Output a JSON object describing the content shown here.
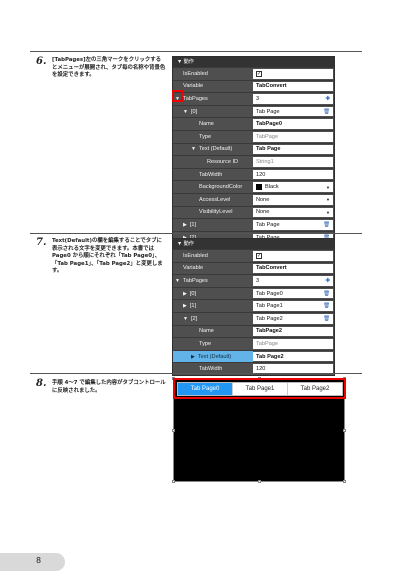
{
  "steps": [
    {
      "num": "6.",
      "text": "[TabPages]左の三角マークをクリックするとメニューが展開され、タブ毎の名称や背景色を設定できます。"
    },
    {
      "num": "7.",
      "text": "Text(Default)の欄を編集することでタブに表示される文字を変更できます。本書では Page0 から順にそれぞれ「Tab Page0」、「Tab Page1」、「Tab Page2」と変更します。"
    },
    {
      "num": "8.",
      "text": "手順 4～7 で編集した内容がタブコントロールに反映されました。"
    }
  ],
  "panel1": {
    "header": "▼ 動作",
    "rows": [
      {
        "name": "IsEnabled",
        "value": "✓"
      },
      {
        "name": "Variable",
        "value": "TabConvert"
      },
      {
        "name": "TabPages",
        "value": "3"
      },
      {
        "name": "[0]",
        "value": "Tab Page"
      },
      {
        "name": "Name",
        "value": "TabPage0"
      },
      {
        "name": "Type",
        "value": "TabPage"
      },
      {
        "name": "Text (Default)",
        "value": "Tab Page"
      },
      {
        "name": "Resource ID",
        "value": "String1"
      },
      {
        "name": "TabWidth",
        "value": "120"
      },
      {
        "name": "BackgroundColor",
        "value": "Black"
      },
      {
        "name": "AccessLevel",
        "value": "None"
      },
      {
        "name": "VisibilityLevel",
        "value": "None"
      },
      {
        "name": "[1]",
        "value": "Tab Page"
      },
      {
        "name": "[2]",
        "value": "Tab Page"
      }
    ]
  },
  "panel2": {
    "header": "▼ 動作",
    "rows": [
      {
        "name": "IsEnabled",
        "value": "✓"
      },
      {
        "name": "Variable",
        "value": "TabConvert"
      },
      {
        "name": "TabPages",
        "value": "3"
      },
      {
        "name": "[0]",
        "value": "Tab Page0"
      },
      {
        "name": "[1]",
        "value": "Tab Page1"
      },
      {
        "name": "[2]",
        "value": "Tab Page2"
      },
      {
        "name": "Name",
        "value": "TabPage2"
      },
      {
        "name": "Type",
        "value": "TabPage"
      },
      {
        "name": "Text (Default)",
        "value": "Tab Page2"
      },
      {
        "name": "TabWidth",
        "value": "120"
      }
    ]
  },
  "preview": {
    "tabs": [
      "Tab Page0",
      "Tab Page1",
      "Tab Page2"
    ]
  },
  "page_number": "8",
  "icons": {
    "expand": "triangle-down-icon",
    "collapse": "triangle-right-icon",
    "add": "plus-icon",
    "delete": "trash-icon",
    "dropdown": "chevron-down-icon"
  },
  "colors": {
    "highlight": "#62b3e8",
    "red_box": "#e00000",
    "active_tab": "#2196f3"
  }
}
